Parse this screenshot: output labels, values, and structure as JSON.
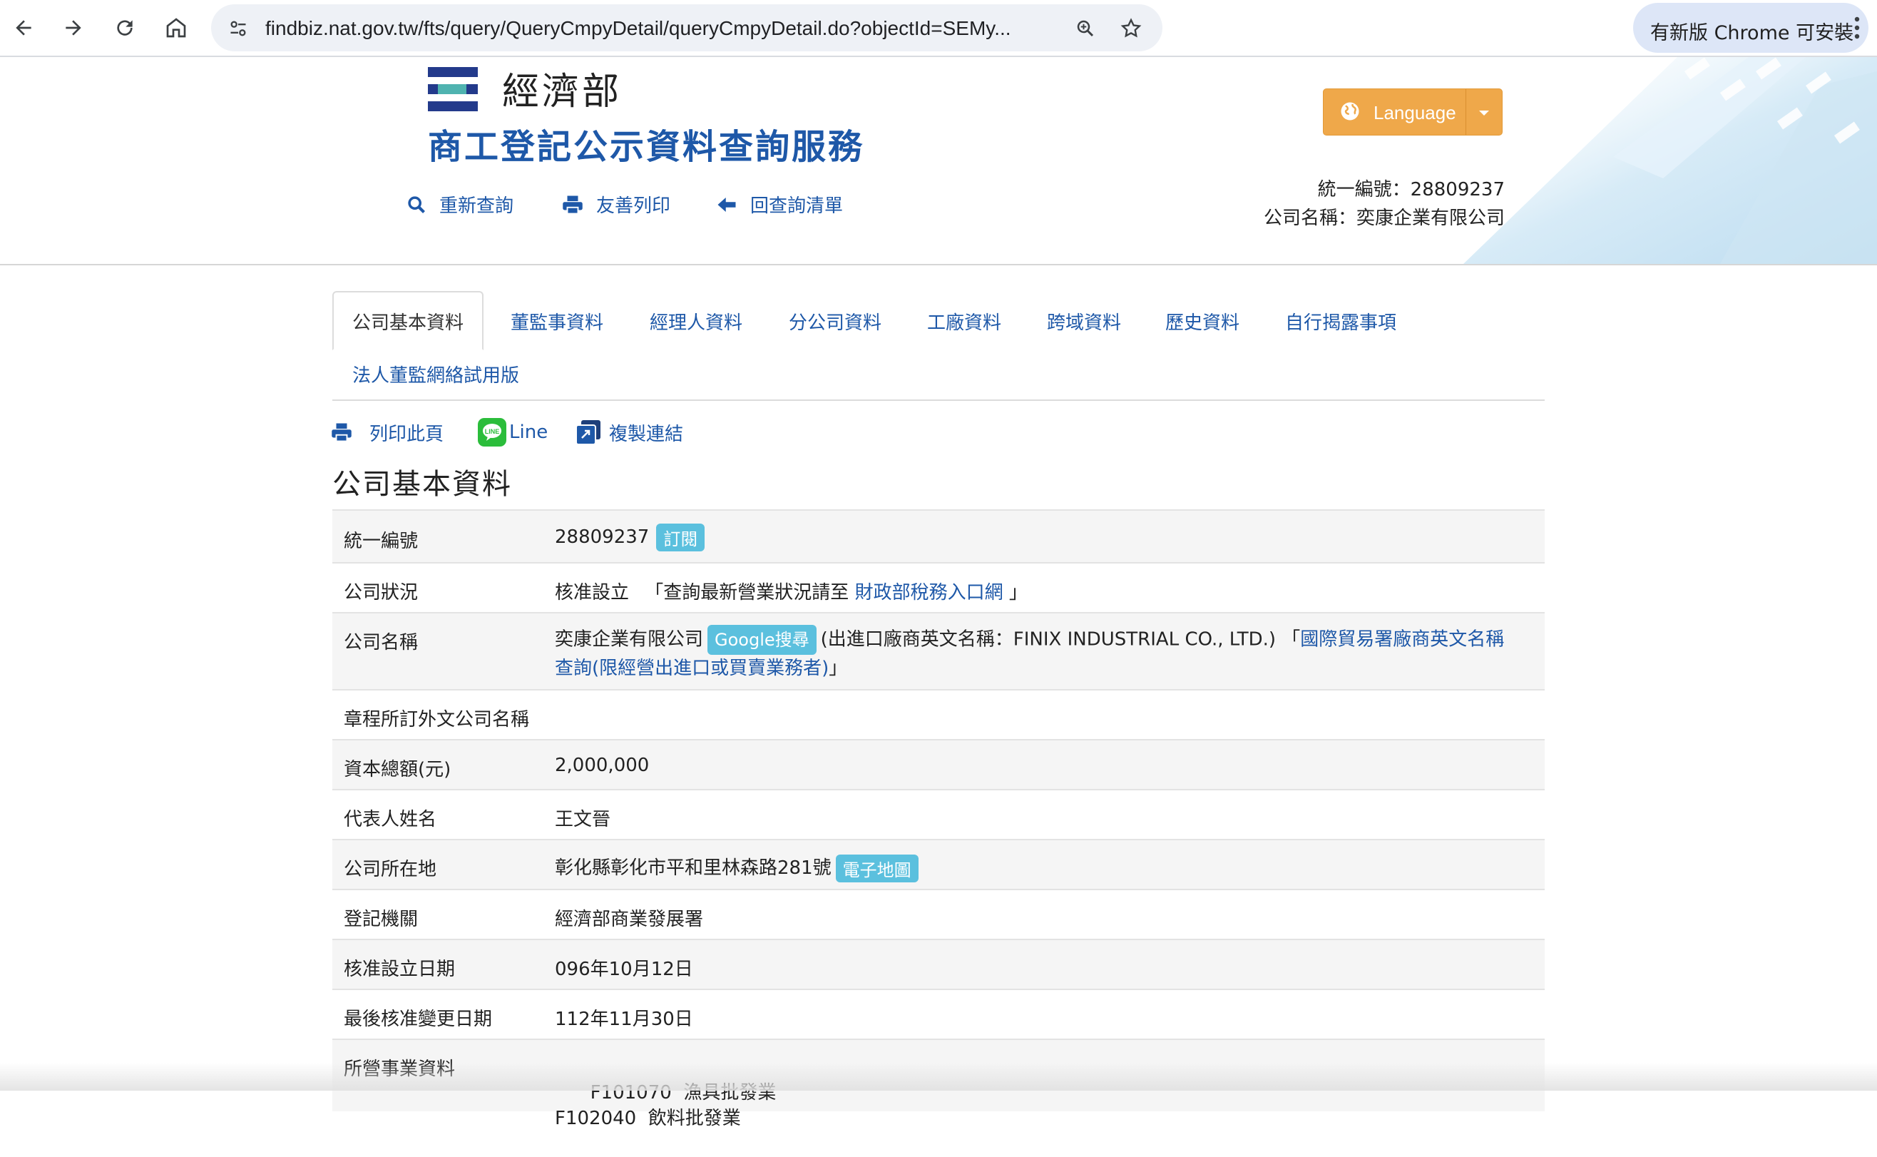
{
  "browser": {
    "url": "findbiz.nat.gov.tw/fts/query/QueryCmpyDetail/queryCmpyDetail.do?objectId=SEMy...",
    "update_label": "有新版 Chrome 可安裝"
  },
  "header": {
    "ministry": "經濟部",
    "service_title": "商工登記公示資料查詢服務",
    "links": [
      "重新查詢",
      "友善列印",
      "回查詢清單"
    ],
    "language_label": "Language",
    "ban_line": "統一編號：28809237",
    "company_line": "公司名稱：奕康企業有限公司"
  },
  "tabs": [
    "公司基本資料",
    "董監事資料",
    "經理人資料",
    "分公司資料",
    "工廠資料",
    "跨域資料",
    "歷史資料",
    "自行揭露事項",
    "法人董監網絡試用版"
  ],
  "tools": {
    "print": "列印此頁",
    "line": "Line",
    "copy": "複製連結"
  },
  "section_title": "公司基本資料",
  "table": {
    "ban_key": "統一編號",
    "ban_value": "28809237",
    "subscribe_badge": "訂閱",
    "status_key": "公司狀況",
    "status_value": "核准設立",
    "status_note_pre": "「查詢最新營業狀況請至",
    "status_link": "財政部稅務入口網",
    "status_note_post": "」",
    "name_key": "公司名稱",
    "name_value": "奕康企業有限公司",
    "google_badge": "Google搜尋",
    "export_name": "(出進口廠商英文名稱：FINIX INDUSTRIAL CO., LTD.)",
    "trade_link_open": "「",
    "trade_link_line1": "國際貿易署廠商英文名稱",
    "trade_link_line2": "查詢(限經營出進口或買賣業務者)",
    "trade_link_close": "」",
    "foreign_name_key": "章程所訂外文公司名稱",
    "capital_key": "資本總額(元)",
    "capital_value": "2,000,000",
    "rep_key": "代表人姓名",
    "rep_value": "王文晉",
    "address_key": "公司所在地",
    "address_value": "彰化縣彰化市平和里林森路281號",
    "map_badge": "電子地圖",
    "authority_key": "登記機關",
    "authority_value": "經濟部商業發展署",
    "approve_date_key": "核准設立日期",
    "approve_date_value": "096年10月12日",
    "last_change_key": "最後核准變更日期",
    "last_change_value": "112年11月30日",
    "business_key": "所營事業資料",
    "business_items": [
      "F101070  漁具批發業",
      "F102040  飲料批發業"
    ]
  },
  "colors": {
    "link": "#1e58a8",
    "language_button": "#efa84a",
    "badge": "#5bc0de"
  }
}
